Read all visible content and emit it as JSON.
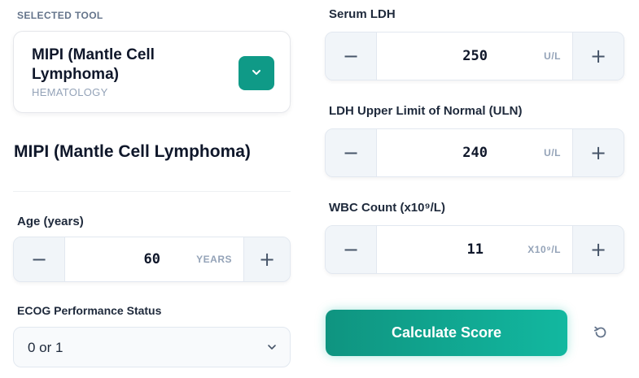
{
  "selected_tool": {
    "section_label": "SELECTED TOOL",
    "name": "MIPI (Mantle Cell Lymphoma)",
    "category": "HEMATOLOGY",
    "toggle_icon": "chevron-down-icon"
  },
  "page_title": "MIPI (Mantle Cell Lymphoma)",
  "fields": {
    "age": {
      "label": "Age (years)",
      "value": "60",
      "unit": "YEARS"
    },
    "ecog": {
      "label": "ECOG Performance Status",
      "selected": "0 or 1"
    },
    "ldh": {
      "label": "Serum LDH",
      "value": "250",
      "unit": "U/L"
    },
    "ldh_uln": {
      "label": "LDH Upper Limit of Normal (ULN)",
      "value": "240",
      "unit": "U/L"
    },
    "wbc": {
      "label": "WBC Count (x10⁹/L)",
      "value": "11",
      "unit": "X10⁹/L"
    }
  },
  "stepper": {
    "decrement": "−",
    "increment": "+"
  },
  "actions": {
    "calculate_label": "Calculate Score",
    "reset_icon": "reset-icon"
  },
  "colors": {
    "accent": "#0f9a87",
    "accent_light": "#12b8a0",
    "muted_text": "#94a3b8"
  }
}
